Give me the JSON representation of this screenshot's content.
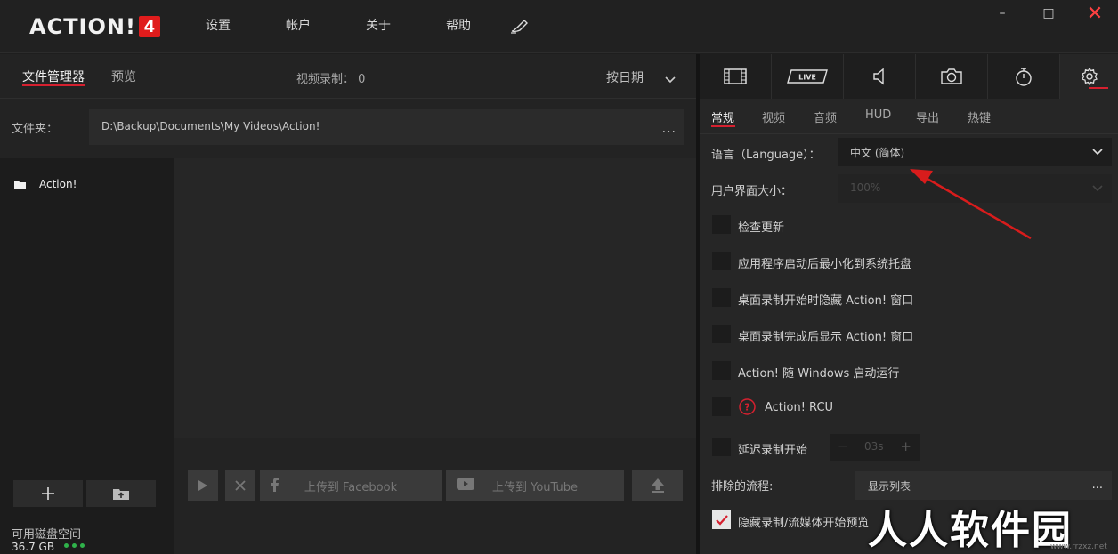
{
  "app": {
    "logo_text": "ACTION!",
    "logo_badge": "4"
  },
  "topnav": {
    "settings": "设置",
    "account": "帐户",
    "about": "关于",
    "help": "帮助"
  },
  "window_controls": {
    "minimize": "–",
    "maximize": "□",
    "close": "✕"
  },
  "left": {
    "tabs": {
      "files": "文件管理器",
      "preview": "预览"
    },
    "recording_count": "视频录制： 0",
    "sort_label": "按日期",
    "folder": {
      "label": "文件夹：",
      "path": "D:\\Backup\\Documents\\My Videos\\Action!",
      "more": "..."
    },
    "tree": {
      "items": [
        {
          "label": "Action!"
        }
      ]
    },
    "disk": {
      "label": "可用磁盘空间",
      "value": "36.7 GB"
    },
    "actions": {
      "facebook": "上传到 Facebook",
      "youtube": "上传到 YouTube"
    }
  },
  "right": {
    "modes": [
      "film-icon",
      "live-icon",
      "audio-icon",
      "camera-icon",
      "timer-icon",
      "gear-icon"
    ],
    "live_label": "LIVE",
    "sub_tabs": [
      "常规",
      "视频",
      "音频",
      "HUD",
      "导出",
      "热键"
    ],
    "language": {
      "label": "语言（Language）：",
      "value": "中文 (简体)"
    },
    "ui_size": {
      "label": "用户界面大小：",
      "value": "100%"
    },
    "options": [
      {
        "label": "检查更新",
        "checked": false
      },
      {
        "label": "应用程序启动后最小化到系统托盘",
        "checked": false
      },
      {
        "label": "桌面录制开始时隐藏 Action! 窗口",
        "checked": false
      },
      {
        "label": "桌面录制完成后显示 Action! 窗口",
        "checked": false
      },
      {
        "label": "Action! 随 Windows 启动运行",
        "checked": false
      },
      {
        "label": "Action! RCU",
        "checked": false
      },
      {
        "label": "延迟录制开始",
        "checked": false
      }
    ],
    "delay": {
      "minus": "−",
      "value": "03s",
      "plus": "+"
    },
    "excluded": {
      "label": "排除的流程:",
      "value": "显示列表",
      "more": "..."
    },
    "hide_preview": {
      "label": "隐藏录制/流媒体开始预览",
      "checked": true
    }
  },
  "watermark": {
    "text": "人人软件园",
    "url": "www.rrzxz.net"
  },
  "colors": {
    "accent": "#d6202f",
    "close": "#ff4141",
    "disk_ok": "#2fb24a"
  }
}
